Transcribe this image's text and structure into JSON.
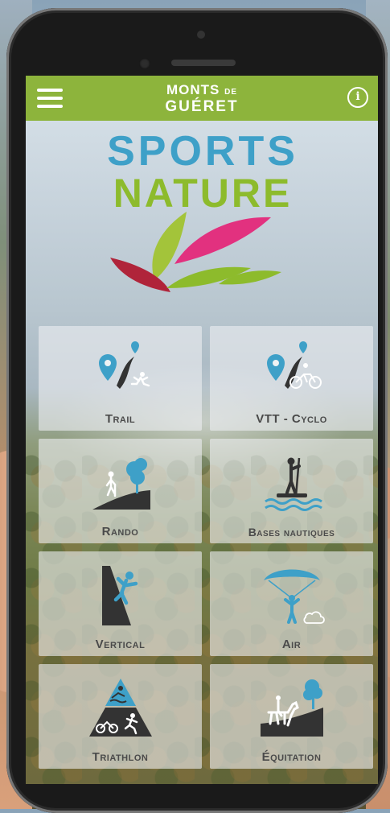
{
  "app": {
    "brand_line1": "MONTS",
    "brand_line1_suffix": "DE",
    "brand_line2": "GUÉRET",
    "logo_line1": "SPORTS",
    "logo_line2": "NATURE"
  },
  "colors": {
    "topbar": "#8db43c",
    "accent_blue": "#3ea0c8",
    "accent_green": "#8dbb2c",
    "accent_pink": "#e2317f",
    "accent_red": "#b0243a",
    "label_gray": "#4a4a4a"
  },
  "header": {
    "menu_icon": "hamburger-menu-icon",
    "info_icon": "info-icon",
    "info_glyph": "i"
  },
  "categories": [
    {
      "label": "Trail",
      "icon": "trail-icon"
    },
    {
      "label": "VTT - Cyclo",
      "icon": "bike-icon"
    },
    {
      "label": "Rando",
      "icon": "hiking-icon"
    },
    {
      "label": "Bases nautiques",
      "icon": "paddle-icon"
    },
    {
      "label": "Vertical",
      "icon": "climbing-icon"
    },
    {
      "label": "Air",
      "icon": "paragliding-icon"
    },
    {
      "label": "Triathlon",
      "icon": "triathlon-icon"
    },
    {
      "label": "Équitation",
      "icon": "horse-riding-icon"
    }
  ]
}
